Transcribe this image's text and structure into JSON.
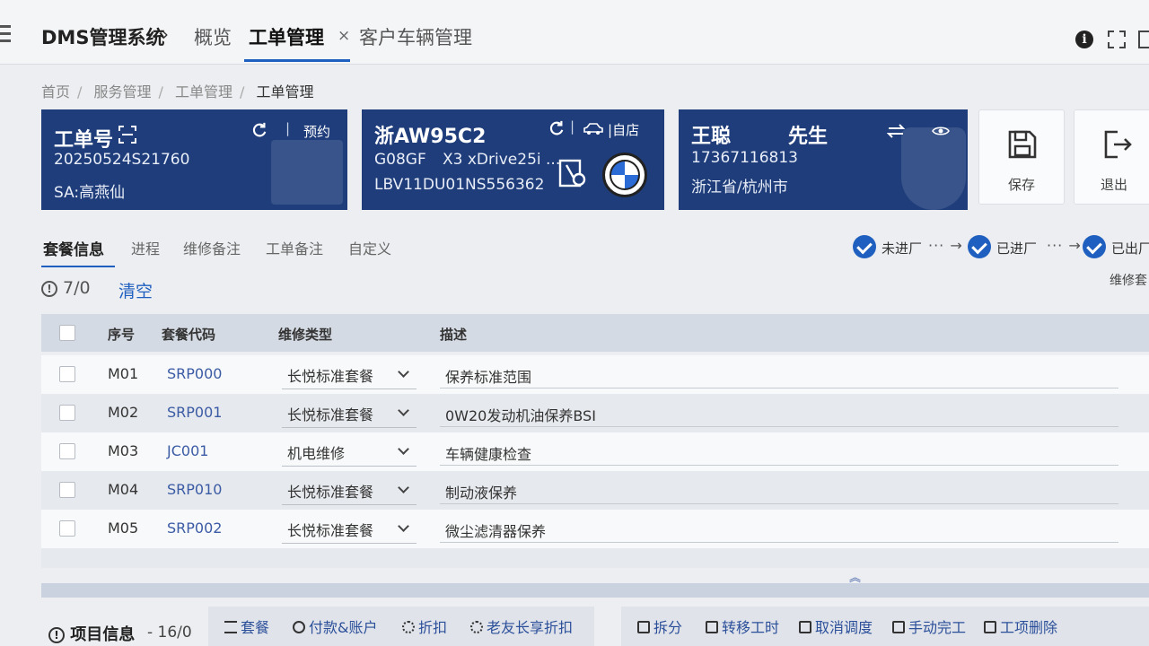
{
  "header": {
    "app_title": "DMS管理系统",
    "tabs": [
      {
        "label": "概览"
      },
      {
        "label": "工单管理"
      },
      {
        "label": "客户车辆管理"
      }
    ],
    "close_symbol": "×",
    "info_symbol": "i"
  },
  "breadcrumb": [
    "首页",
    "服务管理",
    "工单管理",
    "工单管理"
  ],
  "order_card": {
    "title": "工单号",
    "order_no": "20250524S21760",
    "sa": "SA:高燕仙",
    "action": "预约"
  },
  "vehicle_card": {
    "plate": "浙AW95C2",
    "model_code": "G08GF",
    "model": "X3 xDrive25i ...",
    "vin": "LBV11DU01NS556362",
    "source": "自店",
    "brand": "BMW"
  },
  "customer_card": {
    "name": "王聪",
    "title": "先生",
    "phone": "17367116813",
    "region": "浙江省/杭州市"
  },
  "actions": {
    "save": "保存",
    "exit": "退出"
  },
  "subtabs": [
    "套餐信息",
    "进程",
    "维修备注",
    "工单备注",
    "自定义"
  ],
  "progress": [
    {
      "label": "未进厂"
    },
    {
      "label": "已进厂"
    },
    {
      "label": "已出厂"
    }
  ],
  "package_count": "7/0",
  "clear_label": "清空",
  "corner_label": "维修套",
  "table": {
    "headers": [
      "序号",
      "套餐代码",
      "维修类型",
      "描述"
    ],
    "rows": [
      {
        "seq": "M01",
        "code": "SRP000",
        "type": "长悦标准套餐",
        "desc": "保养标准范围"
      },
      {
        "seq": "M02",
        "code": "SRP001",
        "type": "长悦标准套餐",
        "desc": "0W20发动机油保养BSI"
      },
      {
        "seq": "M03",
        "code": "JC001",
        "type": "机电维修",
        "desc": "车辆健康检查"
      },
      {
        "seq": "M04",
        "code": "SRP010",
        "type": "长悦标准套餐",
        "desc": "制动液保养"
      },
      {
        "seq": "M05",
        "code": "SRP002",
        "type": "长悦标准套餐",
        "desc": "微尘滤清器保养"
      }
    ]
  },
  "footer": {
    "title": "项目信息",
    "count": "- 16/0",
    "tools_left": [
      "套餐",
      "付款&账户",
      "折扣",
      "老友长享折扣"
    ],
    "tools_right": [
      "拆分",
      "转移工时",
      "取消调度",
      "手动完工",
      "工项删除"
    ]
  },
  "colors": {
    "card_bg": "#1e3d7a",
    "accent": "#1f5fbf",
    "link": "#3b5ba5"
  }
}
